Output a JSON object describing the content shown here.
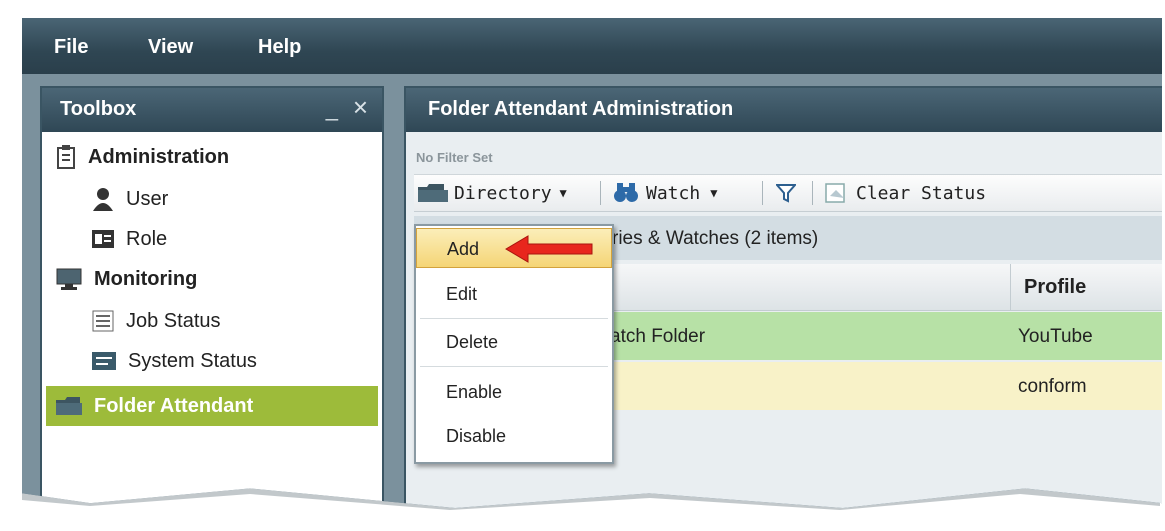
{
  "menu": {
    "file": "File",
    "view": "View",
    "help": "Help"
  },
  "toolbox": {
    "title": "Toolbox",
    "minimize": "_",
    "close": "×",
    "items": [
      {
        "label": "Administration",
        "icon": "clipboard-icon",
        "level": 0
      },
      {
        "label": "User",
        "icon": "user-icon",
        "level": 1
      },
      {
        "label": "Role",
        "icon": "id-card-icon",
        "level": 1
      },
      {
        "label": "Monitoring",
        "icon": "monitor-icon",
        "level": 0
      },
      {
        "label": "Job Status",
        "icon": "list-icon",
        "level": 1
      },
      {
        "label": "System Status",
        "icon": "status-icon",
        "level": 1
      },
      {
        "label": "Folder Attendant",
        "icon": "folder-icon",
        "level": 0,
        "selected": true
      }
    ]
  },
  "admin": {
    "title": "Folder Attendant Administration",
    "filter": "No Filter Set",
    "toolbar": {
      "directory": "Directory",
      "watch": "Watch",
      "clear_status": "Clear Status"
    },
    "group": "ries & Watches (2 items)",
    "column_profile": "Profile",
    "rows": [
      {
        "name": "atch Folder",
        "profile": "YouTube",
        "color": "#b7e1a6"
      },
      {
        "name": "",
        "profile": "conform",
        "color": "#f8f2c8"
      }
    ]
  },
  "dropdown": {
    "items": [
      "Add",
      "Edit",
      "Delete",
      "Enable",
      "Disable"
    ],
    "highlighted": "Add"
  },
  "colors": {
    "header_dark": "#2f4755",
    "selected_green": "#9dbb3a",
    "arrow_red": "#e8261d"
  }
}
